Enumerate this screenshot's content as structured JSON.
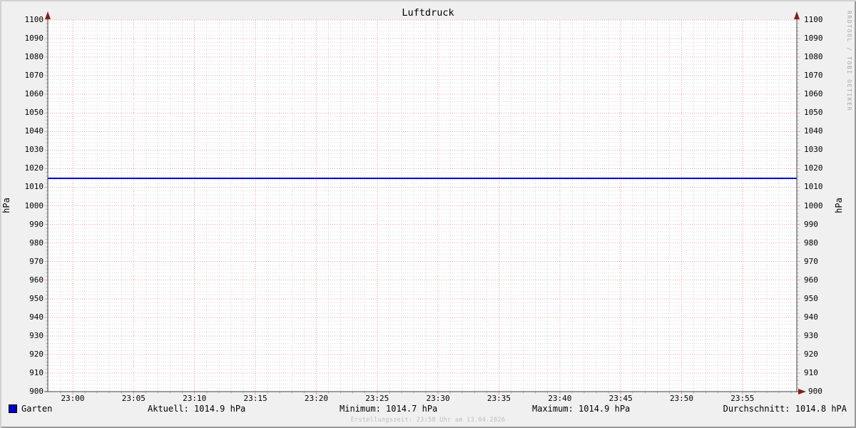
{
  "title": "Luftdruck",
  "watermark": "RRDTOOL / TOBI OETIKER",
  "axes": {
    "left_unit": "hPa",
    "right_unit": "hPa"
  },
  "legend": {
    "series_label": "Garten",
    "current": "Aktuell: 1014.9 hPa",
    "minimum": "Minimum: 1014.7 hPa",
    "maximum": "Maximum: 1014.9 hPa",
    "average": "Durchschnitt: 1014.8 hPA"
  },
  "footer": "Erstellungszeit: 23:58 Uhr am 13.04.2026",
  "colors": {
    "series": "#0000c8",
    "major_grid": "#ee9e9e",
    "minor_grid": "#d8d8d8",
    "axis": "#424242",
    "arrow": "#821f1f",
    "background": "#f0f0f0",
    "plot_background": "#ffffff",
    "text": "#000000"
  },
  "chart_data": {
    "type": "line",
    "title": "Luftdruck",
    "ylabel": "hPa",
    "ylim": [
      900,
      1100
    ],
    "y_tick_step": 10,
    "y_minor_step": 2,
    "grid": true,
    "legend_position": "bottom",
    "y_ticks": [
      900,
      910,
      920,
      930,
      940,
      950,
      960,
      970,
      980,
      990,
      1000,
      1010,
      1020,
      1030,
      1040,
      1050,
      1060,
      1070,
      1080,
      1090,
      1100
    ],
    "x_ticks": [
      "23:00",
      "23:05",
      "23:10",
      "23:15",
      "23:20",
      "23:25",
      "23:30",
      "23:35",
      "23:40",
      "23:45",
      "23:50",
      "23:55"
    ],
    "x_minor_step_minutes": 1,
    "x_major_step_minutes": 5,
    "series": [
      {
        "name": "Garten",
        "color": "#0000c8",
        "x": [
          "23:00",
          "23:05",
          "23:10",
          "23:15",
          "23:20",
          "23:25",
          "23:30",
          "23:35",
          "23:40",
          "23:45",
          "23:50",
          "23:55"
        ],
        "values": [
          1014.8,
          1014.8,
          1014.8,
          1014.8,
          1014.8,
          1014.8,
          1014.8,
          1014.8,
          1014.8,
          1014.8,
          1014.8,
          1014.8
        ]
      }
    ],
    "stats": {
      "current": 1014.9,
      "minimum": 1014.7,
      "maximum": 1014.9,
      "average": 1014.8,
      "unit": "hPa"
    }
  }
}
